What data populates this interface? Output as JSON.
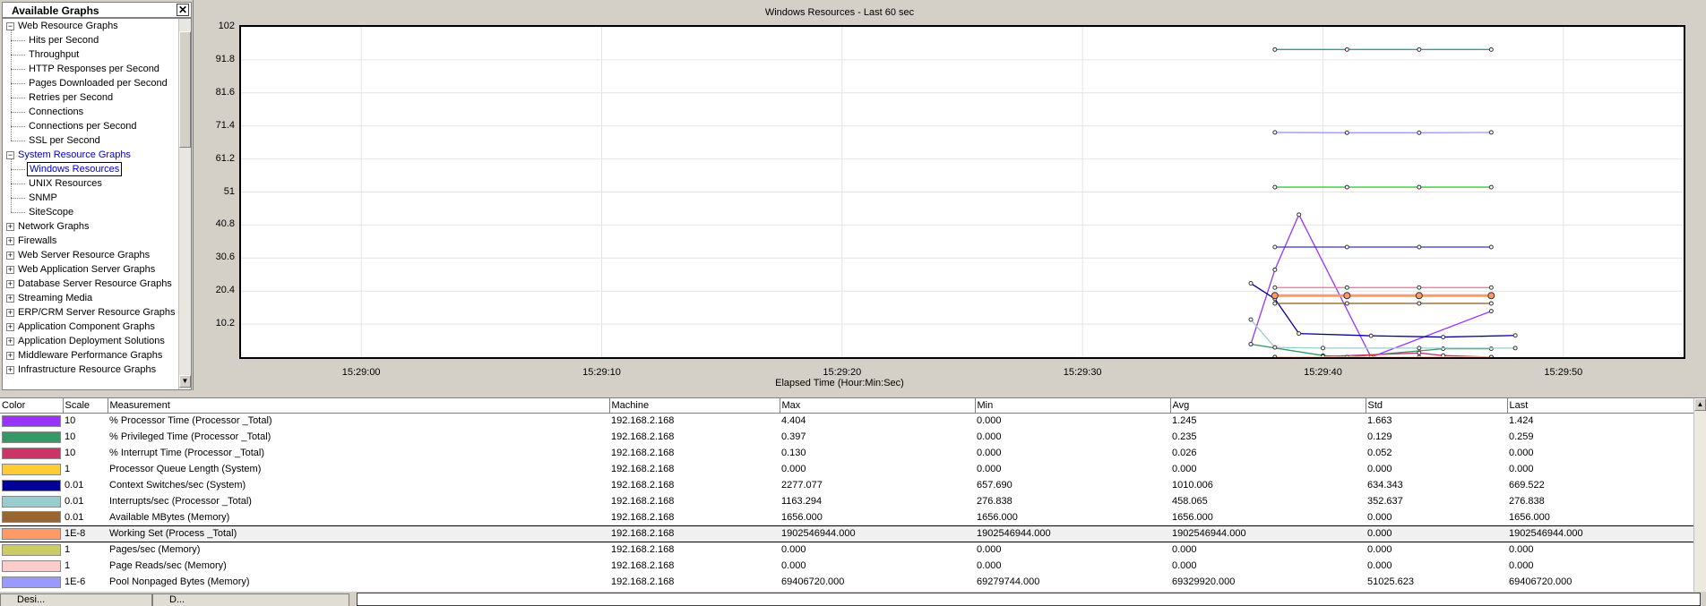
{
  "tree": {
    "title": "Available Graphs",
    "close_label": "✕",
    "items": [
      {
        "label": "Web Resource Graphs",
        "level": 0,
        "expander": "−"
      },
      {
        "label": "Hits per Second",
        "level": 1
      },
      {
        "label": "Throughput",
        "level": 1
      },
      {
        "label": "HTTP Responses per Second",
        "level": 1
      },
      {
        "label": "Pages Downloaded per Second",
        "level": 1
      },
      {
        "label": "Retries per Second",
        "level": 1
      },
      {
        "label": "Connections",
        "level": 1
      },
      {
        "label": "Connections per Second",
        "level": 1
      },
      {
        "label": "SSL per Second",
        "level": 1
      },
      {
        "label": "System Resource Graphs",
        "level": 0,
        "expander": "−",
        "active": true
      },
      {
        "label": "Windows Resources",
        "level": 1,
        "selected": true
      },
      {
        "label": "UNIX Resources",
        "level": 1
      },
      {
        "label": "SNMP",
        "level": 1
      },
      {
        "label": "SiteScope",
        "level": 1
      },
      {
        "label": "Network Graphs",
        "level": 0,
        "expander": "+"
      },
      {
        "label": "Firewalls",
        "level": 0,
        "expander": "+"
      },
      {
        "label": "Web Server Resource Graphs",
        "level": 0,
        "expander": "+"
      },
      {
        "label": "Web Application Server Graphs",
        "level": 0,
        "expander": "+"
      },
      {
        "label": "Database Server Resource Graphs",
        "level": 0,
        "expander": "+"
      },
      {
        "label": "Streaming Media",
        "level": 0,
        "expander": "+"
      },
      {
        "label": "ERP/CRM Server Resource Graphs",
        "level": 0,
        "expander": "+"
      },
      {
        "label": "Application Component Graphs",
        "level": 0,
        "expander": "+"
      },
      {
        "label": "Application Deployment Solutions",
        "level": 0,
        "expander": "+"
      },
      {
        "label": "Middleware Performance Graphs",
        "level": 0,
        "expander": "+"
      },
      {
        "label": "Infrastructure Resource Graphs",
        "level": 0,
        "expander": "+"
      }
    ]
  },
  "chart_data": {
    "type": "line",
    "title": "Windows Resources - Last 60 sec",
    "xlabel": "Elapsed Time (Hour:Min:Sec)",
    "ylabel": "",
    "yticks": [
      "102",
      "91.8",
      "81.6",
      "71.4",
      "61.2",
      "51",
      "40.8",
      "30.6",
      "20.4",
      "10.2"
    ],
    "ylim": [
      0,
      102
    ],
    "xticks": [
      "15:29:00",
      "15:29:10",
      "15:29:20",
      "15:29:30",
      "15:29:40",
      "15:29:50"
    ],
    "xlim": [
      "15:28:55",
      "15:29:55"
    ],
    "grid": true,
    "series": [
      {
        "name": "% Processor Time (Processor _Total)",
        "color": "#9933ff",
        "x": [
          "15:29:37",
          "15:29:38",
          "15:29:39",
          "15:29:42",
          "15:29:47"
        ],
        "y": [
          4.0,
          27.0,
          44.0,
          0.0,
          14.2
        ]
      },
      {
        "name": "% Privileged Time (Processor _Total)",
        "color": "#339966",
        "x": [
          "15:29:37",
          "15:29:40",
          "15:29:41",
          "15:29:45",
          "15:29:47"
        ],
        "y": [
          4.0,
          0.5,
          0.0,
          2.6,
          2.6
        ]
      },
      {
        "name": "% Interrupt Time (Processor _Total)",
        "color": "#cc3366",
        "x": [
          "15:29:40",
          "15:29:44",
          "15:29:45",
          "15:29:47"
        ],
        "y": [
          0.2,
          1.3,
          0.5,
          0.0
        ]
      },
      {
        "name": "Processor Queue Length (System)",
        "color": "#ffff33",
        "x": [
          "15:29:38",
          "15:29:41",
          "15:29:44",
          "15:29:47"
        ],
        "y": [
          0.0,
          0.0,
          0.0,
          0.0
        ]
      },
      {
        "name": "Context Switches/sec (System)",
        "color": "#000099",
        "x": [
          "15:29:37",
          "15:29:38",
          "15:29:39",
          "15:29:42",
          "15:29:45",
          "15:29:48"
        ],
        "y": [
          22.8,
          18.0,
          7.3,
          6.6,
          6.2,
          6.7
        ]
      },
      {
        "name": "Interrupts/sec (Processor _Total)",
        "color": "#99cccc",
        "x": [
          "15:29:37",
          "15:29:38",
          "15:29:40",
          "15:29:44",
          "15:29:48"
        ],
        "y": [
          11.6,
          3.0,
          2.8,
          2.8,
          2.8
        ]
      },
      {
        "name": "Available MBytes (Memory)",
        "color": "#996633",
        "x": [
          "15:29:38",
          "15:29:41",
          "15:29:44",
          "15:29:47"
        ],
        "y": [
          16.6,
          16.6,
          16.6,
          16.6
        ]
      },
      {
        "name": "Working Set (Process _Total)",
        "color": "#ff9966",
        "x": [
          "15:29:38",
          "15:29:41",
          "15:29:44",
          "15:29:47"
        ],
        "y": [
          19.0,
          19.0,
          19.0,
          19.0
        ]
      },
      {
        "name": "Pages/sec (Memory)",
        "color": "#cccc66",
        "x": [
          "15:29:38",
          "15:29:47"
        ],
        "y": [
          0.0,
          0.0
        ]
      },
      {
        "name": "Page Reads/sec (Memory)",
        "color": "#ffcccc",
        "x": [
          "15:29:38",
          "15:29:47"
        ],
        "y": [
          0.0,
          0.0
        ]
      },
      {
        "name": "Pool Nonpaged Bytes (Memory)",
        "color": "#9999ff",
        "x": [
          "15:29:38",
          "15:29:41",
          "15:29:44",
          "15:29:47"
        ],
        "y": [
          69.4,
          69.3,
          69.3,
          69.4
        ]
      },
      {
        "name": "",
        "color": "#339999",
        "x": [
          "15:29:38",
          "15:29:41",
          "15:29:44",
          "15:29:47"
        ],
        "y": [
          95.0,
          95.0,
          95.0,
          95.0
        ]
      },
      {
        "name": "",
        "color": "#33cc33",
        "x": [
          "15:29:38",
          "15:29:41",
          "15:29:44",
          "15:29:47"
        ],
        "y": [
          52.5,
          52.5,
          52.5,
          52.5
        ]
      },
      {
        "name": "",
        "color": "#3333cc",
        "x": [
          "15:29:38",
          "15:29:41",
          "15:29:44",
          "15:29:47"
        ],
        "y": [
          34.0,
          34.0,
          34.0,
          34.0
        ]
      },
      {
        "name": "",
        "color": "#ff6699",
        "x": [
          "15:29:38",
          "15:29:41",
          "15:29:44",
          "15:29:47"
        ],
        "y": [
          21.5,
          21.5,
          21.5,
          21.5
        ]
      }
    ]
  },
  "legend": {
    "headers": [
      "Color",
      "Scale",
      "Measurement",
      "Machine",
      "Max",
      "Min",
      "Avg",
      "Std",
      "Last"
    ],
    "rows": [
      {
        "color": "#9933ff",
        "scale": "10",
        "measurement": "% Processor Time (Processor _Total)",
        "machine": "192.168.2.168",
        "max": "4.404",
        "min": "0.000",
        "avg": "1.245",
        "std": "1.663",
        "last": "1.424"
      },
      {
        "color": "#339966",
        "scale": "10",
        "measurement": "% Privileged Time (Processor _Total)",
        "machine": "192.168.2.168",
        "max": "0.397",
        "min": "0.000",
        "avg": "0.235",
        "std": "0.129",
        "last": "0.259"
      },
      {
        "color": "#cc3366",
        "scale": "10",
        "measurement": "% Interrupt Time (Processor _Total)",
        "machine": "192.168.2.168",
        "max": "0.130",
        "min": "0.000",
        "avg": "0.026",
        "std": "0.052",
        "last": "0.000"
      },
      {
        "color": "#ffcc33",
        "scale": "1",
        "measurement": "Processor Queue Length (System)",
        "machine": "192.168.2.168",
        "max": "0.000",
        "min": "0.000",
        "avg": "0.000",
        "std": "0.000",
        "last": "0.000"
      },
      {
        "color": "#000099",
        "scale": "0.01",
        "measurement": "Context Switches/sec (System)",
        "machine": "192.168.2.168",
        "max": "2277.077",
        "min": "657.690",
        "avg": "1010.006",
        "std": "634.343",
        "last": "669.522"
      },
      {
        "color": "#99cccc",
        "scale": "0.01",
        "measurement": "Interrupts/sec (Processor _Total)",
        "machine": "192.168.2.168",
        "max": "1163.294",
        "min": "276.838",
        "avg": "458.065",
        "std": "352.637",
        "last": "276.838"
      },
      {
        "color": "#996633",
        "scale": "0.01",
        "measurement": "Available MBytes (Memory)",
        "machine": "192.168.2.168",
        "max": "1656.000",
        "min": "1656.000",
        "avg": "1656.000",
        "std": "0.000",
        "last": "1656.000"
      },
      {
        "color": "#ff9966",
        "scale": "1E-8",
        "measurement": "Working Set (Process _Total)",
        "machine": "192.168.2.168",
        "max": "1902546944.000",
        "min": "1902546944.000",
        "avg": "1902546944.000",
        "std": "0.000",
        "last": "1902546944.000",
        "selected": true
      },
      {
        "color": "#cccc66",
        "scale": "1",
        "measurement": "Pages/sec (Memory)",
        "machine": "192.168.2.168",
        "max": "0.000",
        "min": "0.000",
        "avg": "0.000",
        "std": "0.000",
        "last": "0.000"
      },
      {
        "color": "#ffcccc",
        "scale": "1",
        "measurement": "Page Reads/sec (Memory)",
        "machine": "192.168.2.168",
        "max": "0.000",
        "min": "0.000",
        "avg": "0.000",
        "std": "0.000",
        "last": "0.000"
      },
      {
        "color": "#9999ff",
        "scale": "1E-6",
        "measurement": "Pool Nonpaged Bytes (Memory)",
        "machine": "192.168.2.168",
        "max": "69406720.000",
        "min": "69279744.000",
        "avg": "69329920.000",
        "std": "51025.623",
        "last": "69406720.000"
      }
    ]
  },
  "bottom_tabs": [
    "Desi...",
    "D..."
  ],
  "icons": {
    "tree_scroll_down": "▼",
    "legend_scroll_up": "▲"
  }
}
